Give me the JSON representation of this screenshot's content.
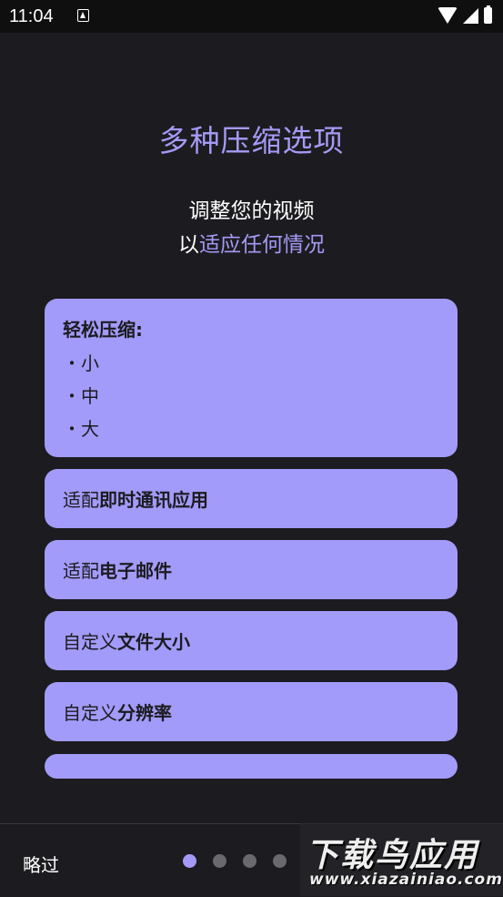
{
  "status_bar": {
    "time": "11:04",
    "notification_icon": "a-box-icon",
    "wifi_icon": "wifi-icon",
    "signal_icon": "signal-icon",
    "battery_icon": "battery-icon"
  },
  "onboarding": {
    "title": "多种压缩选项",
    "subtitle_line1": "调整您的视频",
    "subtitle_line2_prefix": "以",
    "subtitle_line2_accent": "适应任何情况",
    "easy_card": {
      "heading": "轻松压缩:",
      "items": [
        "・小",
        "・中",
        "・大"
      ]
    },
    "options": [
      {
        "prefix": "适配",
        "bold": "即时通讯应用"
      },
      {
        "prefix": "适配",
        "bold": "电子邮件"
      },
      {
        "prefix": "自定义",
        "bold": "文件大小"
      },
      {
        "prefix": "自定义",
        "bold": "分辨率"
      }
    ]
  },
  "bottom_bar": {
    "skip_label": "略过",
    "page_count": 4,
    "active_page": 1
  },
  "watermark": {
    "line1": "下载鸟应用",
    "line2": "www.xiazainiao.com"
  },
  "colors": {
    "background": "#1c1b1f",
    "accent": "#a49af6",
    "card": "#a29bf9"
  }
}
